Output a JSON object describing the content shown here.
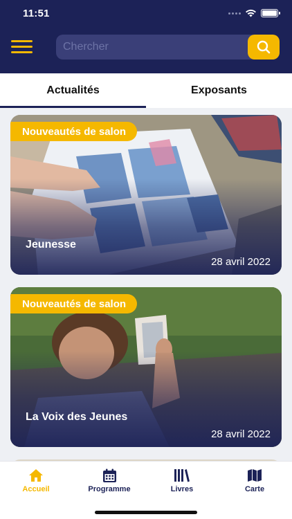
{
  "status_bar": {
    "time": "11:51"
  },
  "search": {
    "placeholder": "Chercher"
  },
  "tabs": [
    {
      "label": "Actualités",
      "active": true
    },
    {
      "label": "Exposants",
      "active": false
    }
  ],
  "cards": [
    {
      "badge": "Nouveautés de salon",
      "title": "Jeunesse",
      "date": "28 avril 2022"
    },
    {
      "badge": "Nouveautés de salon",
      "title": "La Voix des Jeunes",
      "date": "28 avril 2022"
    }
  ],
  "nav": [
    {
      "label": "Accueil",
      "icon": "home-icon",
      "active": true
    },
    {
      "label": "Programme",
      "icon": "calendar-icon",
      "active": false
    },
    {
      "label": "Livres",
      "icon": "books-icon",
      "active": false
    },
    {
      "label": "Carte",
      "icon": "map-icon",
      "active": false
    }
  ],
  "colors": {
    "navy": "#1c2257",
    "accent": "#f5b800",
    "background": "#eef0f4"
  }
}
